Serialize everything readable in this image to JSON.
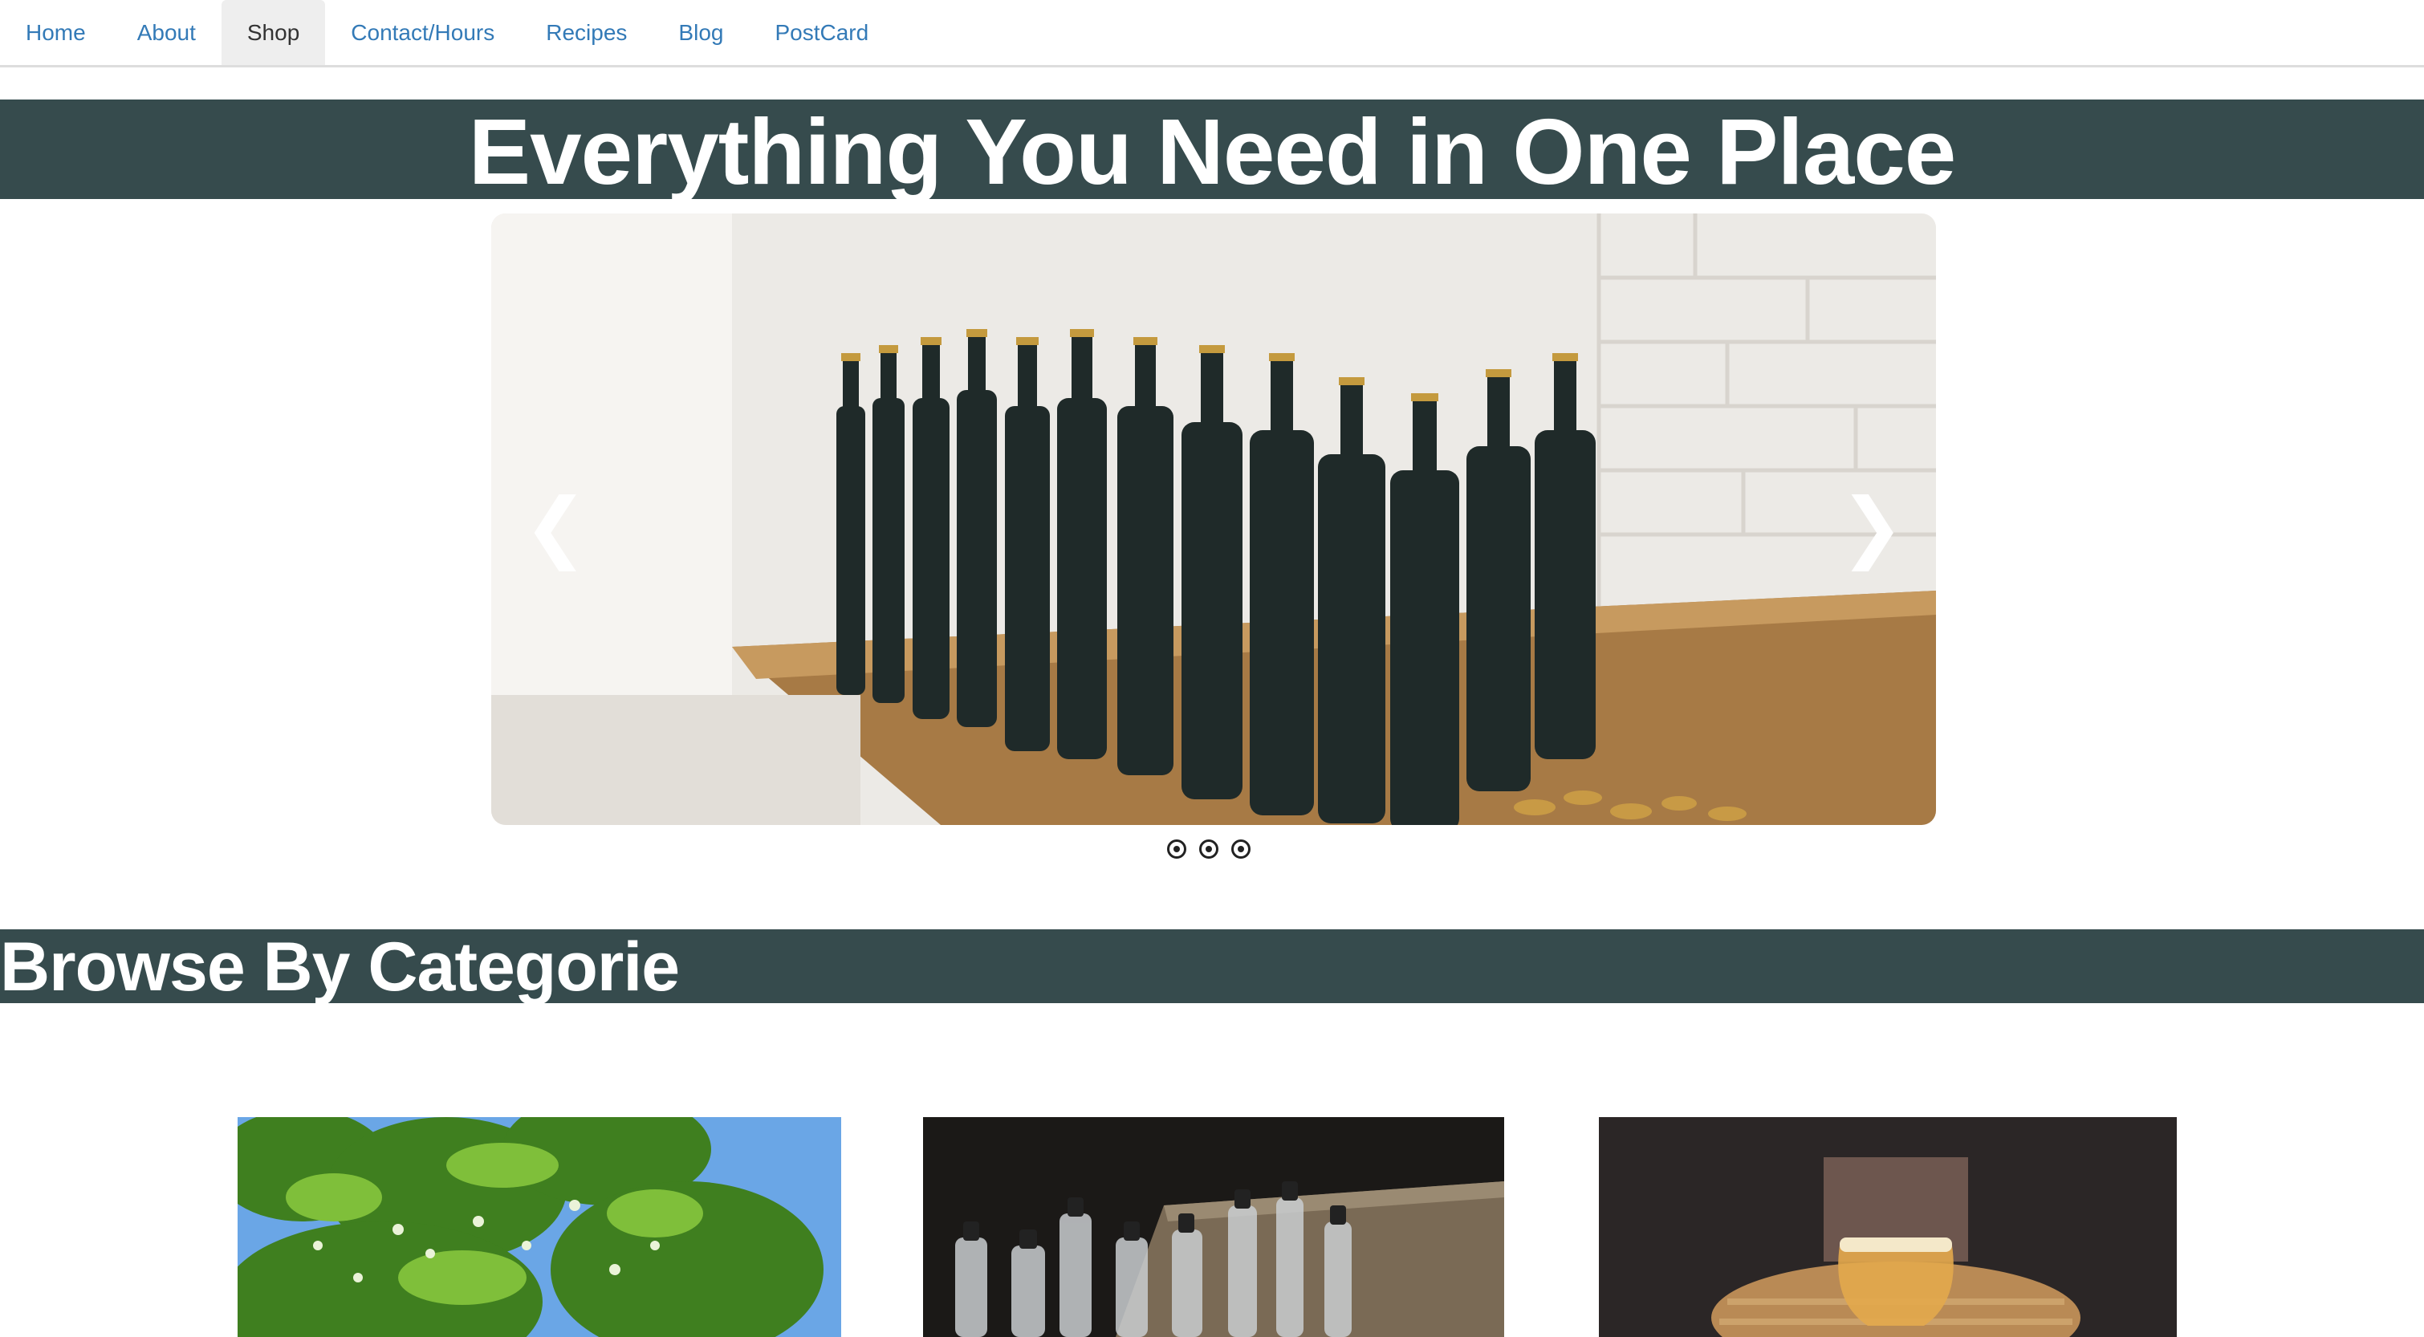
{
  "nav": {
    "items": [
      {
        "label": "Home"
      },
      {
        "label": "About"
      },
      {
        "label": "Shop"
      },
      {
        "label": "Contact/Hours"
      },
      {
        "label": "Recipes"
      },
      {
        "label": "Blog"
      },
      {
        "label": "PostCard"
      }
    ],
    "active": "Shop"
  },
  "hero": {
    "title": "Everything You Need in One Place"
  },
  "carousel": {
    "prev_icon": "chevron-left-icon",
    "next_icon": "chevron-right-icon",
    "prev_glyph": "❮",
    "next_glyph": "❯",
    "slide_count": 3,
    "slide_image": "dark beer bottles on wooden shelf"
  },
  "categories": {
    "title": "Browse By Categorie",
    "cards": [
      {
        "image": "green hops on vine"
      },
      {
        "image": "empty glass bottles in wooden crate"
      },
      {
        "image": "glass of beer on bar"
      }
    ]
  },
  "colors": {
    "band": "#364b4d",
    "link": "#337ab7",
    "active_tab_bg": "#eeeeee"
  }
}
